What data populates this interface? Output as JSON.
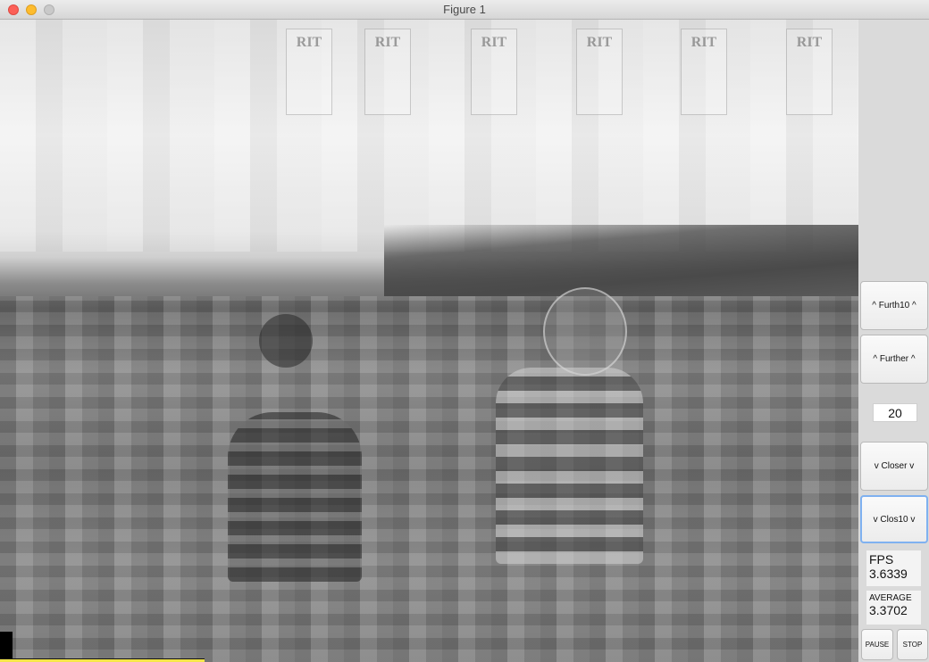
{
  "window": {
    "title": "Figure 1"
  },
  "banners": [
    "RIT",
    "RIT",
    "RIT",
    "RIT",
    "RIT",
    "RIT"
  ],
  "controls": {
    "further10": "^ Furth10 ^",
    "further": "^ Further ^",
    "distance_value": "20",
    "closer": "v Closer v",
    "closer10": "v Clos10 v",
    "pause": "PAUSE",
    "stop": "STOP"
  },
  "stats": {
    "fps_label": "FPS",
    "fps_value": "3.6339",
    "avg_label": "AVERAGE",
    "avg_value": "3.3702"
  },
  "colors": {
    "close": "#fc5f57",
    "minimize": "#fdbc2e",
    "maximize": "#c9c9c9",
    "focus_ring": "#7fb1f0"
  }
}
